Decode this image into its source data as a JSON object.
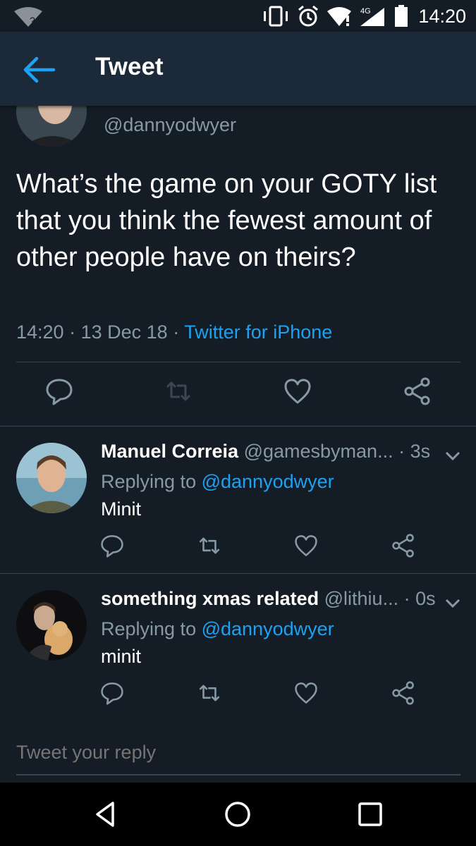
{
  "status_bar": {
    "time": "14:20",
    "network": "4G",
    "wifi_badge": "?",
    "icons": [
      "wifi-unknown-icon",
      "vibrate-icon",
      "alarm-icon",
      "wifi-icon",
      "cell-signal-icon",
      "battery-icon"
    ]
  },
  "app_bar": {
    "title": "Tweet",
    "back_icon": "arrow-left-icon"
  },
  "main_tweet": {
    "handle": "@dannyodwyer",
    "text": "What’s the game on your GOTY list that you think the fewest amount of other people have on theirs?",
    "time": "14:20",
    "date": "13 Dec 18",
    "source": "Twitter for iPhone",
    "separator": "·"
  },
  "replies": [
    {
      "name": "Manuel Correia",
      "handle": "@gamesbyman...",
      "time": "· 3s",
      "replying_prefix": "Replying to ",
      "replying_to": "@dannyodwyer",
      "text": "Minit"
    },
    {
      "name": "something xmas related",
      "handle": "@lithiu...",
      "time": "· 0s",
      "replying_prefix": "Replying to ",
      "replying_to": "@dannyodwyer",
      "text": "minit"
    }
  ],
  "reply_box": {
    "placeholder": "Tweet your reply"
  },
  "colors": {
    "background": "#141d26",
    "header": "#1c2938",
    "accent": "#1da1f2",
    "secondary_text": "#8899a6",
    "divider": "#38444d"
  }
}
